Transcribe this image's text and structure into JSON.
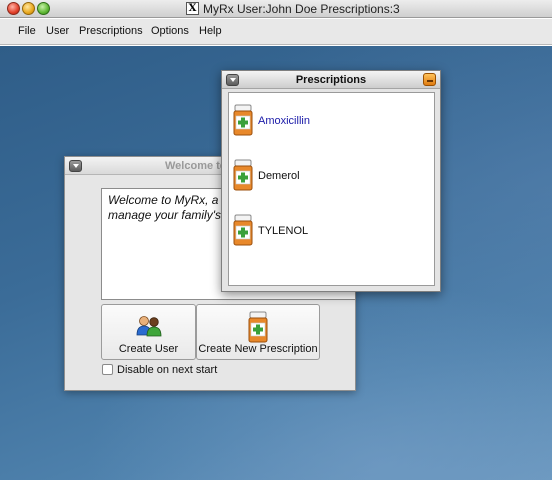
{
  "window": {
    "x_badge": "X",
    "title": "MyRx User:John Doe  Prescriptions:3"
  },
  "menu": [
    "File",
    "User",
    "Prescriptions",
    "Options",
    "Help"
  ],
  "welcome": {
    "title": "Welcome to",
    "text_line1": "Welcome to MyRx, a co",
    "text_line2": "manage your family's m",
    "create_user": "Create User",
    "create_prescription": "Create New Prescription",
    "disable_label": "Disable on next start",
    "disable_checked": false
  },
  "prescriptions": {
    "title": "Prescriptions",
    "items": [
      {
        "name": "Amoxicillin",
        "selected": true
      },
      {
        "name": "Demerol",
        "selected": false
      },
      {
        "name": "TYLENOL",
        "selected": false
      }
    ]
  },
  "icons": {
    "pill_bottle": "pill-bottle-icon",
    "users": "users-icon"
  },
  "colors": {
    "selected_text": "#1a1aa8",
    "bottle_orange": "#e8882a",
    "cross_green": "#3aa03a"
  }
}
